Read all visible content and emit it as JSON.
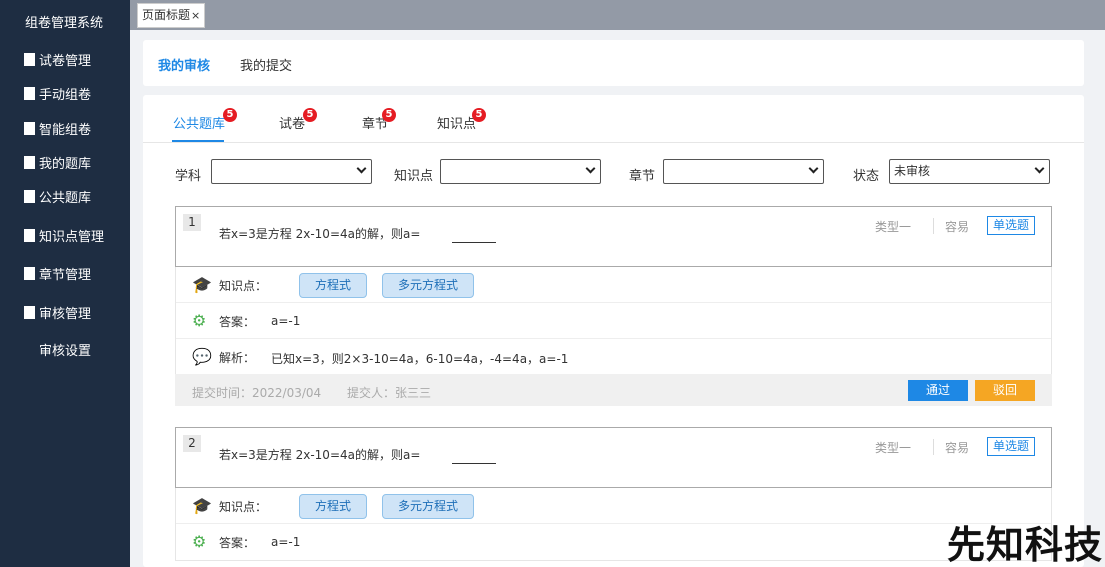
{
  "app": {
    "title": "组卷管理系统"
  },
  "sidebar": {
    "items": [
      {
        "label": "试卷管理"
      },
      {
        "label": "手动组卷"
      },
      {
        "label": "智能组卷"
      },
      {
        "label": "我的题库"
      },
      {
        "label": "公共题库"
      },
      {
        "label": "知识点管理"
      },
      {
        "label": "章节管理"
      },
      {
        "label": "审核管理"
      }
    ],
    "sub_item": {
      "label": "审核设置"
    }
  },
  "topbar": {
    "page_tab": "页面标题",
    "close": "×"
  },
  "review_tabs": [
    {
      "label": "我的审核",
      "active": true
    },
    {
      "label": "我的提交",
      "active": false
    }
  ],
  "sub_tabs": [
    {
      "label": "公共题库",
      "badge": "5",
      "active": true
    },
    {
      "label": "试卷",
      "badge": "5",
      "active": false
    },
    {
      "label": "章节",
      "badge": "5",
      "active": false
    },
    {
      "label": "知识点",
      "badge": "5",
      "active": false
    }
  ],
  "filters": {
    "subject": {
      "label": "学科",
      "value": ""
    },
    "knowledge": {
      "label": "知识点",
      "value": ""
    },
    "chapter": {
      "label": "章节",
      "value": ""
    },
    "status": {
      "label": "状态",
      "value": "未审核"
    }
  },
  "questions": [
    {
      "num": "1",
      "text": "若x=3是方程 2x-10=4a的解，则a=",
      "type": "类型一",
      "difficulty": "容易",
      "kind": "单选题",
      "knowledge_label": "知识点：",
      "knowledge_tags": [
        "方程式",
        "多元方程式"
      ],
      "answer_label": "答案：",
      "answer": "a=-1",
      "analysis_label": "解析：",
      "analysis": "已知x=3，则2×3-10=4a，6-10=4a，-4=4a，a=-1",
      "submit_time": "提交时间：2022/03/04",
      "submitter": "提交人：张三三",
      "pass_label": "通过",
      "reject_label": "驳回"
    },
    {
      "num": "2",
      "text": "若x=3是方程 2x-10=4a的解，则a=",
      "type": "类型一",
      "difficulty": "容易",
      "kind": "单选题",
      "knowledge_label": "知识点：",
      "knowledge_tags": [
        "方程式",
        "多元方程式"
      ],
      "answer_label": "答案：",
      "answer": "a=-1"
    }
  ],
  "watermark": "先知科技",
  "colors": {
    "sidebar": "#1e2d42",
    "accent": "#1e88e5",
    "badge": "#e51c23",
    "reject": "#f5a623"
  }
}
